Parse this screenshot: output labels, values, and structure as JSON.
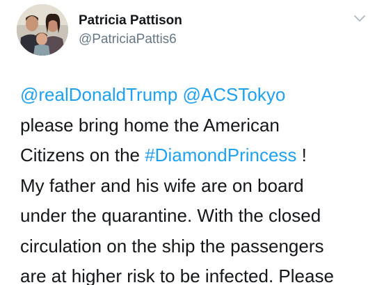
{
  "user": {
    "display_name": "Patricia Pattison",
    "handle": "@PatriciaPattis6"
  },
  "tweet": {
    "line1": {
      "mention1": "@realDonaldTrump",
      "space": " ",
      "mention2": "@ACSTokyo"
    },
    "line2": "please bring home the American",
    "line3": {
      "before": "Citizens on the ",
      "hashtag": "#DiamondPrincess",
      "after": " !"
    },
    "line4": "My father and his wife are on board",
    "line5": "under the quarantine. With the closed",
    "line6": "circulation on the ship the passengers",
    "line7": "are at higher risk to be infected. Please"
  },
  "icons": {
    "menu": "chevron-down-icon",
    "avatar": "avatar"
  },
  "colors": {
    "link": "#1da1f2",
    "handle": "#657786",
    "text": "#14171a"
  }
}
